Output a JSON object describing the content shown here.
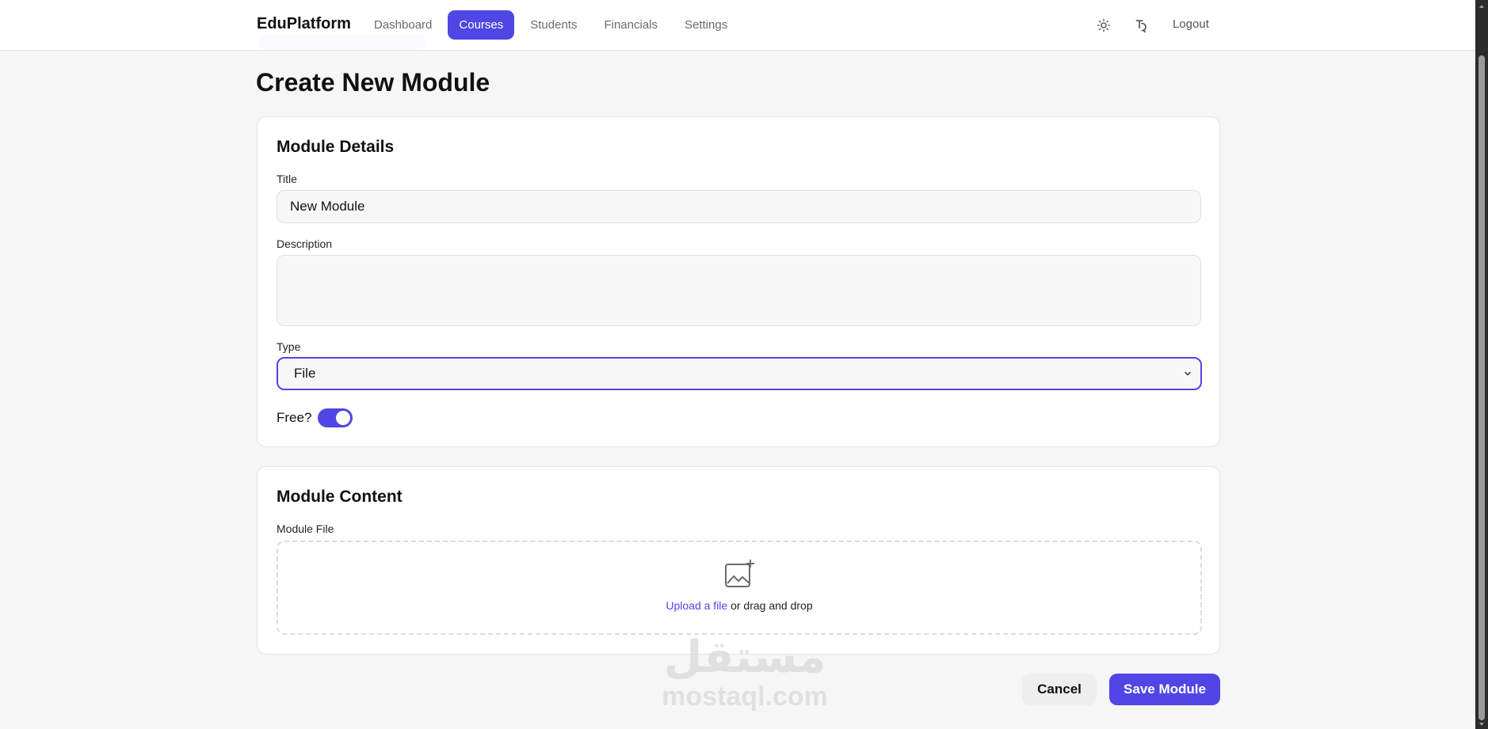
{
  "header": {
    "brand": "EduPlatform",
    "nav": [
      "Dashboard",
      "Courses",
      "Students",
      "Financials",
      "Settings"
    ],
    "active_nav": "Courses",
    "logout_label": "Logout",
    "icons": [
      "sun-icon",
      "language-icon"
    ]
  },
  "page": {
    "title": "Create New Module"
  },
  "details": {
    "title": "Module Details",
    "title_label": "Title",
    "title_value": "New Module",
    "description_label": "Description",
    "description_value": "",
    "type_label": "Type",
    "type_value": "File",
    "free_label": "Free?",
    "free_enabled": true
  },
  "content": {
    "title": "Module Content",
    "file_label": "Module File",
    "upload_link": "Upload a file",
    "upload_rest": " or drag and drop"
  },
  "actions": {
    "cancel": "Cancel",
    "save": "Save Module"
  },
  "watermark": {
    "arabic": "مستقل",
    "latin": "mostaql.com"
  },
  "colors": {
    "accent": "#4f46e5",
    "background": "#f6f6f6",
    "card": "#ffffff"
  }
}
